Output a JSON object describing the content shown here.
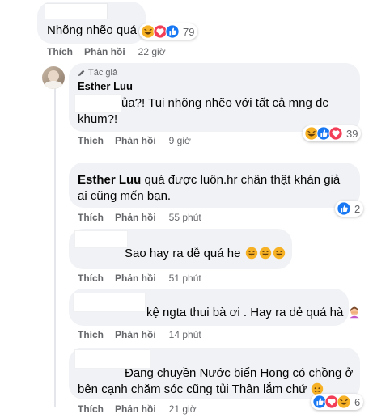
{
  "comments": [
    {
      "text": "Nhõng nhẽo quá",
      "reaction_count": "79",
      "reactions": [
        "haha",
        "love",
        "like"
      ],
      "actions": {
        "like": "Thích",
        "reply": "Phản hồi",
        "time": "22 giờ"
      }
    },
    {
      "author_badge": "Tác giả",
      "author": "Esther Luu",
      "text": "ủa?! Tui nhõng nhẽo với tất cả mng dc khum?!",
      "reaction_count": "39",
      "reactions": [
        "haha",
        "like",
        "love"
      ],
      "actions": {
        "like": "Thích",
        "reply": "Phản hồi",
        "time": "9 giờ"
      }
    },
    {
      "author": "Esther Luu",
      "text": "quá được luôn.hr chân thật khán giả ai cũng mến bạn.",
      "reaction_count": "2",
      "reactions": [
        "like"
      ],
      "actions": {
        "like": "Thích",
        "reply": "Phản hồi",
        "time": "55 phút"
      }
    },
    {
      "text": "Sao hay ra dễ quá he",
      "actions": {
        "like": "Thích",
        "reply": "Phản hồi",
        "time": "51 phút"
      }
    },
    {
      "text": "kệ ngta thui bà ơi . Hay ra dẻ quá hà",
      "actions": {
        "like": "Thích",
        "reply": "Phản hồi",
        "time": "14 phút"
      }
    },
    {
      "text": "Đang chuyền Nước biển Hong có chồng ở bên cạnh chăm sóc cũng tủi Thân lắm chứ",
      "reaction_count": "6",
      "reactions": [
        "like",
        "love",
        "haha"
      ],
      "actions": {
        "like": "Thích",
        "reply": "Phản hồi",
        "time": "21 giờ"
      }
    }
  ],
  "icons": {
    "like": "like-icon",
    "love": "love-icon",
    "haha": "haha-icon",
    "pencil": "pencil-icon",
    "avatar": "avatar"
  },
  "colors": {
    "bubble": "#f0f2f5",
    "meta": "#65676b",
    "like_blue": "#1877f2",
    "love_red": "#f33e58",
    "haha_yellow": "#f7b125"
  }
}
